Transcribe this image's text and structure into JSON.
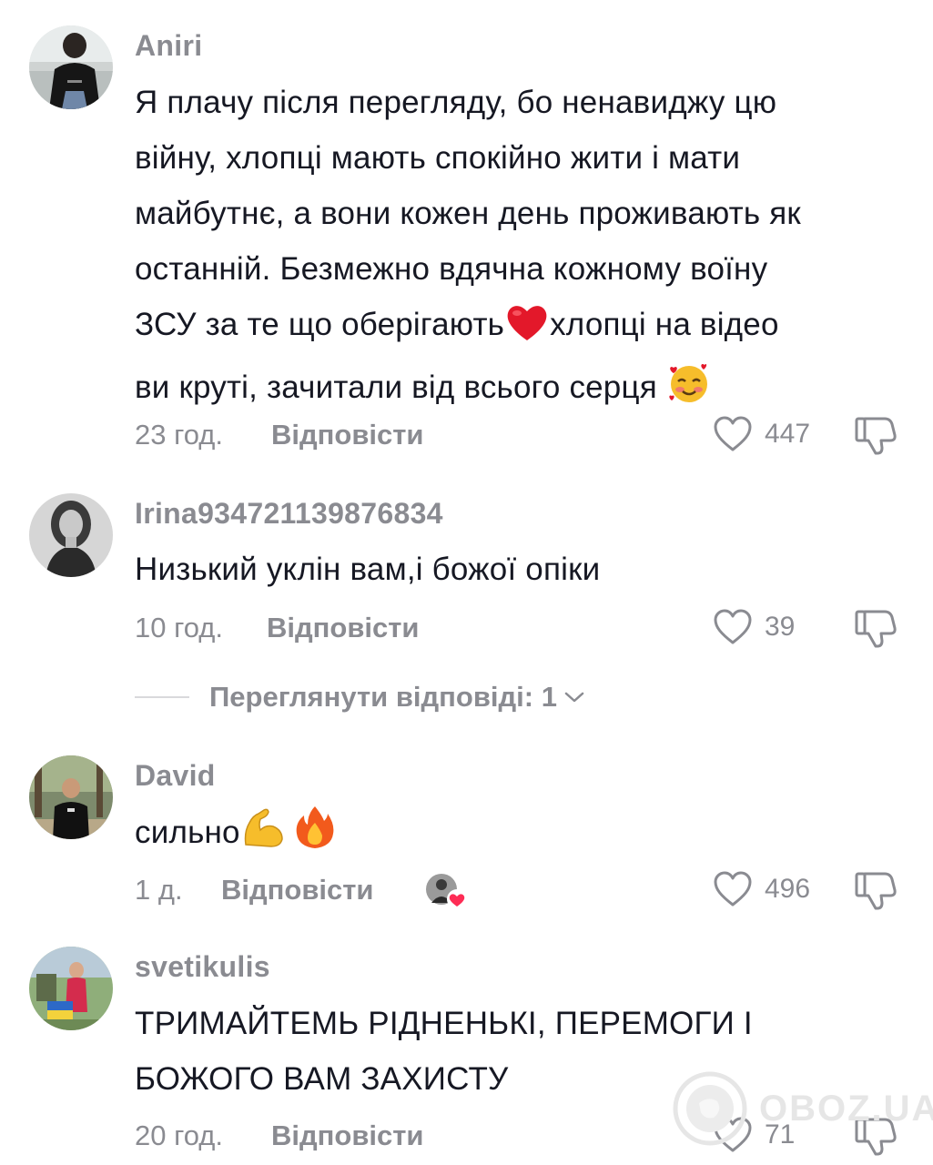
{
  "comments": [
    {
      "username": "Aniri",
      "text_lines": [
        "Я плачу після перегляду, бо ненавиджу цю",
        "війну, хлопці мають спокійно жити і мати",
        "майбутнє, а вони кожен день проживають як",
        "останній. Безмежно вдячна кожному воїну",
        "ЗСУ за те що оберігають",
        "хлопці на відео",
        "ви круті, зачитали від всього серця"
      ],
      "time": "23 год.",
      "reply_label": "Відповісти",
      "likes": "447"
    },
    {
      "username": "Irina934721139876834",
      "text": "Низький уклін вам,і божої опіки",
      "time": "10 год.",
      "reply_label": "Відповісти",
      "likes": "39",
      "view_replies": "Переглянути відповіді: 1"
    },
    {
      "username": "David",
      "text": "сильно",
      "time": "1 д.",
      "reply_label": "Відповісти",
      "likes": "496"
    },
    {
      "username": "svetikulis",
      "text_lines": [
        "ТРИМАЙТЕМЬ РІДНЕНЬКІ, ПЕРЕМОГИ І",
        "БОЖОГО ВАМ ЗАХИСТУ"
      ],
      "time": "20 год.",
      "reply_label": "Відповісти",
      "likes": "71"
    }
  ],
  "watermark": "OBOZ.UA",
  "colors": {
    "text": "#161823",
    "secondary": "#8a8b91",
    "heart_red": "#fe2c55"
  },
  "icons": [
    "heart-outline-icon",
    "dislike-icon",
    "chevron-down-icon",
    "red-heart-emoji",
    "smiling-face-with-hearts-emoji",
    "flexed-biceps-emoji",
    "fire-emoji",
    "creator-liked-badge"
  ]
}
